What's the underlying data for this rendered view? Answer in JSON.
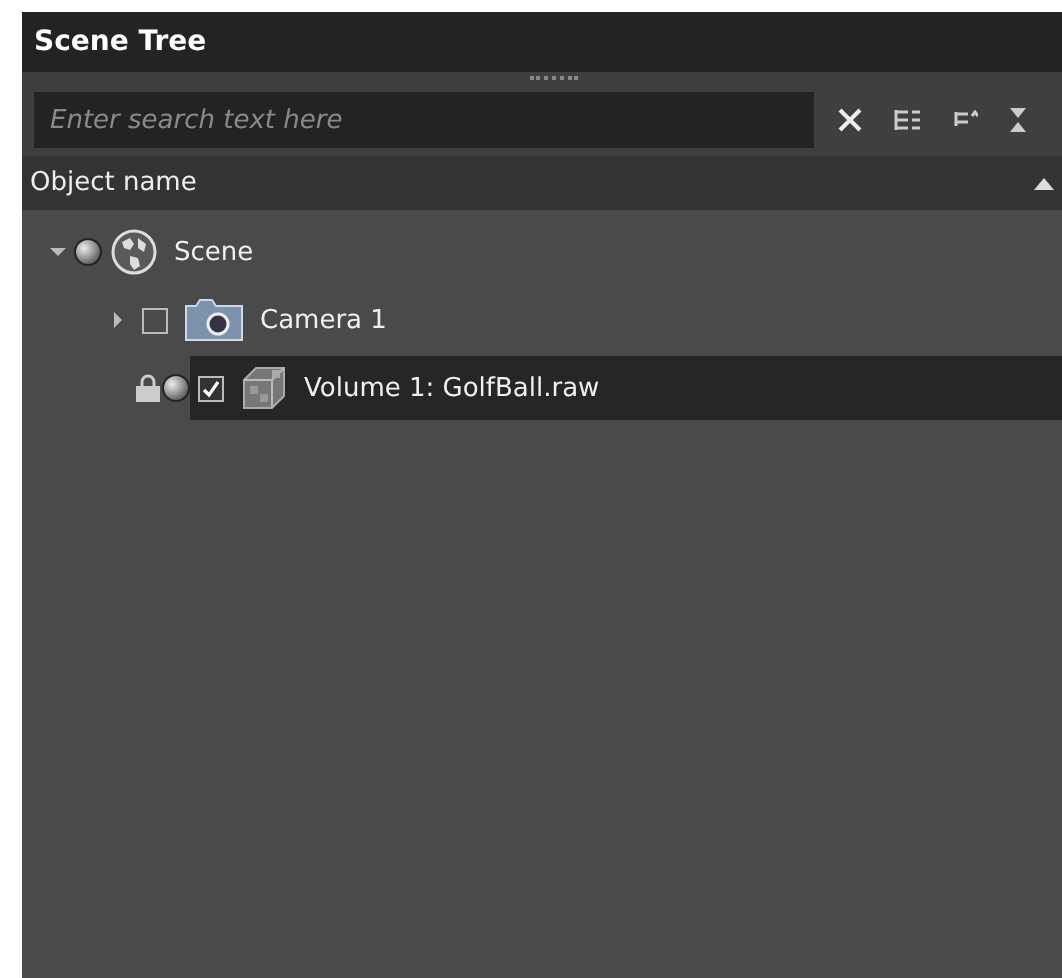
{
  "panel": {
    "title": "Scene Tree"
  },
  "search": {
    "placeholder": "Enter search text here"
  },
  "header": {
    "label": "Object name"
  },
  "tree": [
    {
      "kind": "scene",
      "name": "Scene",
      "expanded": true,
      "visible": true,
      "selected": false,
      "children": [
        {
          "kind": "camera",
          "name": "Camera 1",
          "expanded": false,
          "checked": false,
          "selected": false
        },
        {
          "kind": "volume",
          "name": "Volume 1: GolfBall.raw",
          "locked": true,
          "visible": true,
          "checked": true,
          "selected": true
        }
      ]
    }
  ]
}
